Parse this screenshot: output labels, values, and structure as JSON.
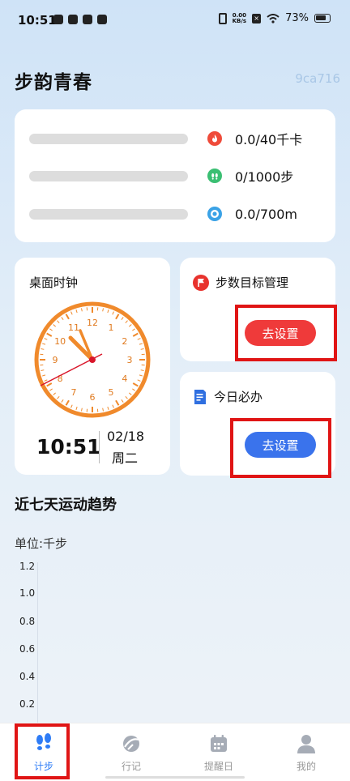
{
  "status_bar": {
    "time": "10:51",
    "net_speed": "0.00",
    "net_unit": "KB/s",
    "battery": "73%"
  },
  "header": {
    "title": "步韵青春",
    "code": "9ca716"
  },
  "stats": [
    {
      "icon": "flame-icon",
      "value": "0.0/40千卡",
      "color": "#ef4b3a"
    },
    {
      "icon": "footprints-icon",
      "value": "0/1000步",
      "color": "#3bbf73"
    },
    {
      "icon": "target-icon",
      "value": "0.0/700m",
      "color": "#3aa2e6"
    }
  ],
  "clock_card": {
    "title": "桌面时钟",
    "numbers": [
      "12",
      "1",
      "2",
      "3",
      "4",
      "5",
      "6",
      "7",
      "8",
      "9",
      "10",
      "11"
    ],
    "time": "10:51",
    "date": "02/18",
    "weekday": "周二"
  },
  "goal_card": {
    "title": "步数目标管理",
    "button": "去设置",
    "accent": "#ef3a3a"
  },
  "todo_card": {
    "title": "今日必办",
    "button": "去设置",
    "accent": "#3a73ec"
  },
  "trend": {
    "title": "近七天运动趋势",
    "unit": "单位:千步",
    "ticks": [
      "1.2",
      "1.0",
      "0.8",
      "0.6",
      "0.4",
      "0.2"
    ]
  },
  "tabs": [
    {
      "label": "计步",
      "icon": "footsteps-icon",
      "active": true
    },
    {
      "label": "行记",
      "icon": "planet-icon",
      "active": false
    },
    {
      "label": "提醒日",
      "icon": "calendar-icon",
      "active": false
    },
    {
      "label": "我的",
      "icon": "user-icon",
      "active": false
    }
  ],
  "colors": {
    "accent_blue": "#2e7cf6",
    "accent_red": "#ef3a3a",
    "clock_orange": "#f08a2c"
  }
}
